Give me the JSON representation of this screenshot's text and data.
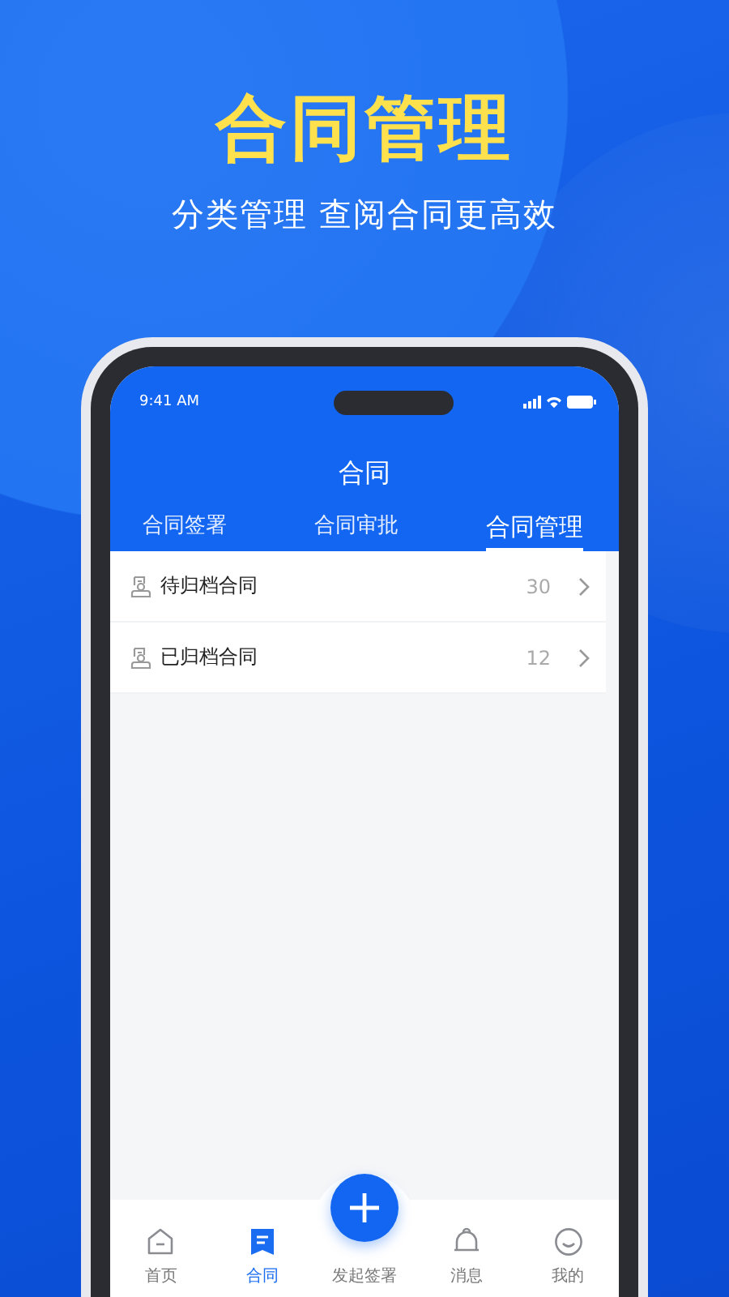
{
  "headline": "合同管理",
  "subtitle": "分类管理 查阅合同更高效",
  "status_bar": {
    "time": "9:41 AM"
  },
  "header": {
    "title": "合同"
  },
  "tabs": [
    {
      "label": "合同签署",
      "selected": false
    },
    {
      "label": "合同审批",
      "selected": false
    },
    {
      "label": "合同管理",
      "selected": true
    }
  ],
  "items": [
    {
      "label": "待归档合同",
      "count": "30"
    },
    {
      "label": "已归档合同",
      "count": "12"
    }
  ],
  "nav": [
    {
      "label": "首页",
      "kind": "home",
      "selected": false
    },
    {
      "label": "合同",
      "kind": "contract",
      "selected": true
    },
    {
      "label": "发起签署",
      "kind": "action",
      "selected": false
    },
    {
      "label": "消息",
      "kind": "bell",
      "selected": false
    },
    {
      "label": "我的",
      "kind": "smile",
      "selected": false
    }
  ]
}
